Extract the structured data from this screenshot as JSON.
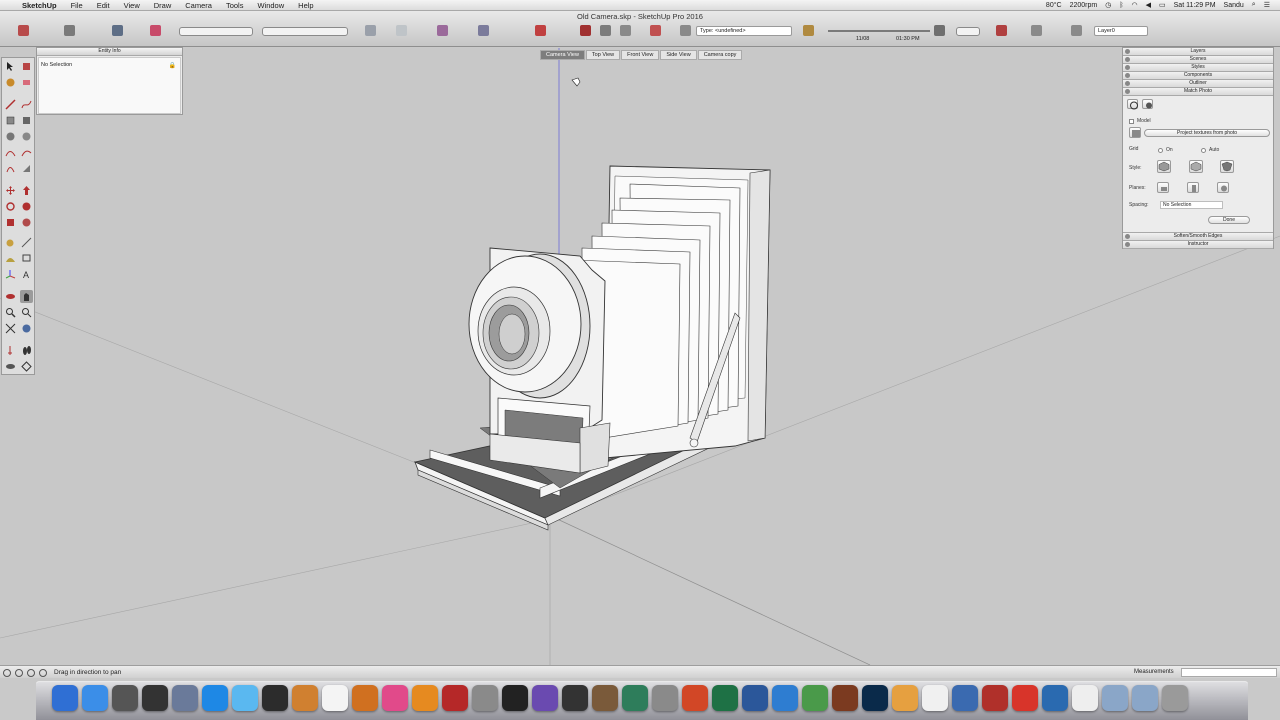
{
  "menubar": {
    "app_name": "SketchUp",
    "menus": [
      "File",
      "Edit",
      "View",
      "Draw",
      "Camera",
      "Tools",
      "Window",
      "Help"
    ],
    "weather": "80°C",
    "weather_sub": "2200rpm",
    "clock": "Sat 11:29 PM",
    "user": "Sandu"
  },
  "window": {
    "title": "Old Camera.skp - SketchUp Pro 2016"
  },
  "toolbar": {
    "layer_type_value": "Type: <undefined>",
    "layer_value": "Layer0",
    "shadow_time_1": "11/08",
    "shadow_time_2": "01:30 PM"
  },
  "scene_tabs": [
    {
      "label": "Camera View",
      "active": true
    },
    {
      "label": "Top View",
      "active": false
    },
    {
      "label": "Front View",
      "active": false
    },
    {
      "label": "Side View",
      "active": false
    },
    {
      "label": "Camera copy",
      "active": false
    }
  ],
  "entity_info": {
    "title": "Entity Info",
    "selection": "No Selection"
  },
  "tray": {
    "panels_top": [
      "Layers",
      "Scenes",
      "Styles",
      "Components",
      "Outliner",
      "Match Photo"
    ],
    "panels_bottom": [
      "Soften/Smooth Edges",
      "Instructor"
    ],
    "match_photo": {
      "model_label": "Model",
      "project_button": "Project textures from photo",
      "grid_label": "Grid",
      "grid_on": "On",
      "grid_auto": "Auto",
      "style_label": "Style:",
      "planes_label": "Planes:",
      "spacing_label": "Spacing:",
      "spacing_value": "No Selection",
      "done_button": "Done"
    }
  },
  "statusbar": {
    "hint": "Drag in direction to pan",
    "measurements_label": "Measurements"
  },
  "colors": {
    "viewport_bg": "#c8c8c8",
    "axis_blue": "#3a3aff",
    "axis_red": "#c04040",
    "axis_green": "#40a040"
  },
  "dock_icons": [
    "finder-icon",
    "app-store-icon",
    "system-icon",
    "dashboard-icon",
    "preview-icon",
    "safari-icon",
    "messages-icon",
    "facetime-icon",
    "books-icon",
    "calendar-icon",
    "photos-icon",
    "itunes-icon",
    "ibooks-icon",
    "sketch-icon",
    "photo-booth-icon",
    "lightroom-icon",
    "imovie-icon",
    "unity-icon",
    "guitar-icon",
    "time-machine-icon",
    "settings-icon",
    "powerpoint-icon",
    "excel-icon",
    "word-icon",
    "lync-icon",
    "smultron-icon",
    "bridge-icon",
    "photoshop-icon",
    "folder-icon",
    "preview2-icon",
    "network-icon",
    "filezilla-icon",
    "sketchup-icon",
    "quicktime-icon",
    "document-icon",
    "applications-icon",
    "downloads-icon",
    "trash-icon"
  ]
}
